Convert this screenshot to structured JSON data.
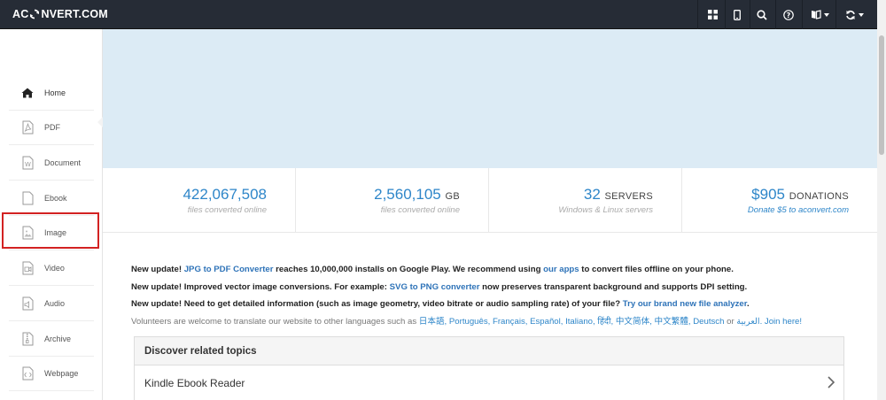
{
  "header": {
    "logo_prefix": "AC",
    "logo_suffix": "NVERT.COM"
  },
  "sidebar": {
    "items": [
      {
        "label": "Home",
        "icon": "home-icon"
      },
      {
        "label": "PDF",
        "icon": "pdf-icon"
      },
      {
        "label": "Document",
        "icon": "document-icon"
      },
      {
        "label": "Ebook",
        "icon": "ebook-icon"
      },
      {
        "label": "Image",
        "icon": "image-icon"
      },
      {
        "label": "Video",
        "icon": "video-icon"
      },
      {
        "label": "Audio",
        "icon": "audio-icon"
      },
      {
        "label": "Archive",
        "icon": "archive-icon"
      },
      {
        "label": "Webpage",
        "icon": "webpage-icon"
      }
    ]
  },
  "stats": [
    {
      "value": "422,067,508",
      "unit": "",
      "sub": "files converted online"
    },
    {
      "value": "2,560,105",
      "unit": "GB",
      "sub": "files converted online"
    },
    {
      "value": "32",
      "unit": "SERVERS",
      "sub": "Windows & Linux servers"
    },
    {
      "value": "$905",
      "unit": "DONATIONS",
      "sub": "Donate $5 to aconvert.com"
    }
  ],
  "updates": {
    "l1_a": "New update! ",
    "l1_link": "JPG to PDF Converter",
    "l1_b": " reaches 10,000,000 installs on Google Play. We recommend using ",
    "l1_link2": "our apps",
    "l1_c": " to convert files offline on your phone.",
    "l2_a": "New update! Improved vector image conversions. For example: ",
    "l2_link": "SVG to PNG converter",
    "l2_b": " now preserves transparent background and supports DPI setting.",
    "l3_a": "New update! Need to get detailed information (such as image geometry, video bitrate or audio sampling rate) of your file? ",
    "l3_link": "Try our brand new file analyzer",
    "l3_b": ".",
    "l4_a": "Volunteers are welcome to translate our website to other languages such as ",
    "l4_langs": "日本語, Português, Français, Español, Italiano, हिंदी, 中文简体, 中文繁體, Deutsch",
    "l4_or": " or ",
    "l4_ar": "العربية",
    "l4_join": ". Join here!"
  },
  "topics": {
    "heading": "Discover related topics",
    "rows": [
      "Kindle Ebook Reader"
    ]
  },
  "colors": {
    "topbar": "#262c36",
    "banner": "#dcebf5",
    "accent": "#2e86c9",
    "highlight": "#d32222"
  }
}
